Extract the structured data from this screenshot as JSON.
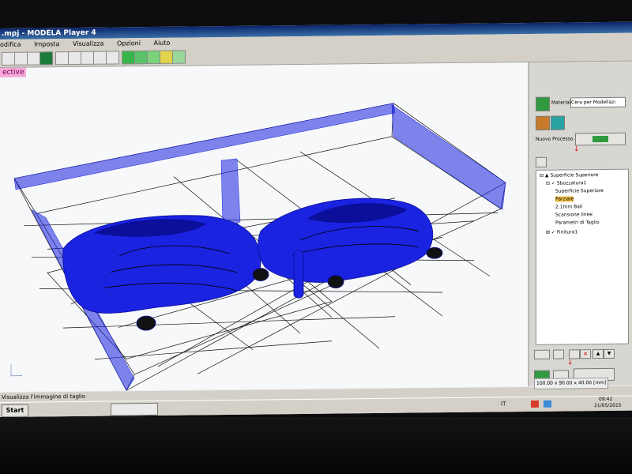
{
  "window": {
    "title": ".mpj - MODELA Player 4",
    "menus": [
      "odifica",
      "Imposta",
      "Visualizza",
      "Opzioni",
      "Aiuto"
    ]
  },
  "viewport": {
    "view_label": "ective"
  },
  "panel": {
    "material_label": "Materiale",
    "material_value": "Cera per Modellazi",
    "nuovo_processo_label": "Nuovo Processo",
    "tree": [
      {
        "label": "Superficie Superiore",
        "level": 0
      },
      {
        "label": "Sbozzatura1",
        "level": 1
      },
      {
        "label": "Superficie Superiore",
        "level": 2
      },
      {
        "label": "Parziale",
        "level": 2
      },
      {
        "label": "2.1mm Ball",
        "level": 2
      },
      {
        "label": "Scansione linee",
        "level": 2
      },
      {
        "label": "Parametri di Taglio",
        "level": 2
      },
      {
        "label": "Finitura1",
        "level": 1
      }
    ],
    "dimensions": "100.00 x 90.00 x 40.00 [mm]"
  },
  "status": {
    "text": "Visualizza l'immagine di taglio"
  },
  "taskbar": {
    "start_label": "Start",
    "language": "IT",
    "time": "09:42",
    "date": "21/05/2015"
  },
  "colors": {
    "mesh_blue": "#1a23e0",
    "wire_black": "#111111",
    "highlight_pink": "#f4a9d8",
    "panel_bg": "#d8d6d0"
  }
}
